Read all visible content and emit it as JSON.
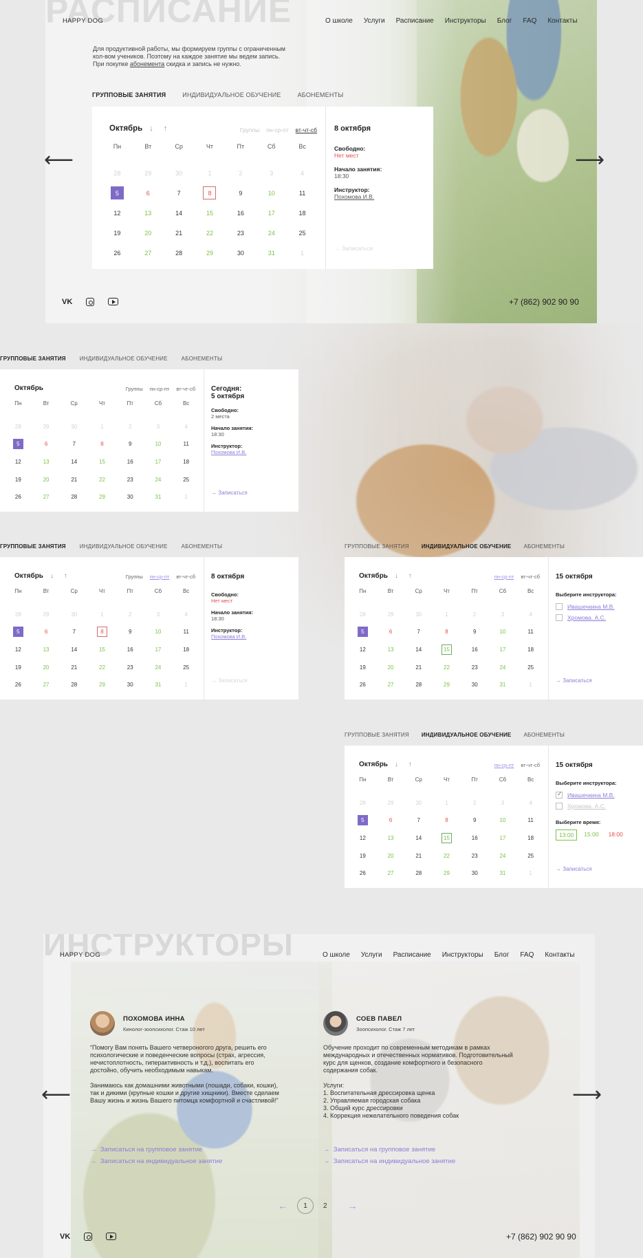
{
  "nav": {
    "logo": "HAPPY DOG",
    "links": [
      "О школе",
      "Услуги",
      "Расписание",
      "Инструкторы",
      "Блог",
      "FAQ",
      "Контакты"
    ]
  },
  "schedule_section": {
    "ghost_title": "РАСПИСАНИЕ",
    "intro_line1": "Для продуктивной работы, мы формируем группы с ограниченным",
    "intro_line2": "кол-вом учеников. Поэтому на каждое занятие мы ведем запись.",
    "intro_line3_pre": "При покупке ",
    "intro_line3_link": "абонемента",
    "intro_line3_post": " скидка и запись не нужно."
  },
  "tabs": [
    "ГРУППОВЫЕ ЗАНЯТИЯ",
    "ИНДИВИДУАЛЬНОЕ ОБУЧЕНИЕ",
    "АБОНЕМЕНТЫ"
  ],
  "calendar": {
    "month": "Октябрь",
    "arrows": "↓ ↑",
    "mode_groups": "Группы",
    "mode_mwf": "пн-ср-пт",
    "mode_tts": "вт-чт-сб",
    "dow": [
      "Пн",
      "Вт",
      "Ср",
      "Чт",
      "Пт",
      "Сб",
      "Вс"
    ],
    "days": [
      [
        "28",
        "29",
        "30",
        "1",
        "2",
        "3",
        "4"
      ],
      [
        "5",
        "6",
        "7",
        "8",
        "9",
        "10",
        "11"
      ],
      [
        "12",
        "13",
        "14",
        "15",
        "16",
        "17",
        "18"
      ],
      [
        "19",
        "20",
        "21",
        "22",
        "23",
        "24",
        "25"
      ],
      [
        "26",
        "27",
        "28",
        "29",
        "30",
        "31",
        "1"
      ]
    ]
  },
  "panel_a": {
    "date": "8 октября",
    "free_label": "Свободно:",
    "free_value": "Нет мест",
    "start_label": "Начало занятия:",
    "start_value": "18:30",
    "instructor_label": "Инструктор:",
    "instructor_value": "Похомова И.В.",
    "enroll": "Записаться"
  },
  "panel_b": {
    "date_line1": "Сегодня:",
    "date_line2": "5 октября",
    "free_label": "Свободно:",
    "free_value": "2 места",
    "start_label": "Начало занятия:",
    "start_value": "18:30",
    "instructor_label": "Инструктор:",
    "instructor_value": "Похомова И.В.",
    "enroll": "Записаться"
  },
  "panel_d": {
    "date": "15 октября",
    "choose_instructor": "Выберите инструктора:",
    "instructor_1": "Ивашечкина М.В.",
    "instructor_2": "Хромова. А.С.",
    "enroll": "Записаться"
  },
  "panel_e": {
    "date": "15 октября",
    "choose_instructor": "Выберите инструктора:",
    "instructor_1": "Ивашечкина М.В.",
    "instructor_2": "Хромова. А.С.",
    "choose_time": "Выберите время:",
    "times": [
      "13:00",
      "15:00",
      "18:00"
    ],
    "enroll": "Записаться"
  },
  "footer": {
    "vk": "vk-icon",
    "instagram": "instagram-icon",
    "youtube": "youtube-icon",
    "phone": "+7 (862) 902 90 90"
  },
  "instructors_section": {
    "ghost_title": "ИНСТРУКТОРЫ",
    "people": [
      {
        "name": "ПОХОМОВА ИННА",
        "role": "Кинолог-зоопсихолог. Стаж 10 лет",
        "desc": "“Помогу Вам понять Вашего четвероногого друга, решить его психологические и поведенческие вопросы (страх, агрессия, нечистоплотность, гиперактивность и т.д.), воспитать его достойно, обучить необходимым навыкам.\n\nЗанимаюсь как домашними животными (лошади, собаки, кошки), так и дикими (крупные кошки и другие хищники). Вместе сделаем Вашу жизнь и жизнь Вашего питомца комфортной и счастливой!”",
        "link_group": "Записаться на групповое занятие",
        "link_individual": "Записаться на индивидуальное занятие"
      },
      {
        "name": "СОЕВ ПАВЕЛ",
        "role": "Зоопсихолог. Стаж 7 лет",
        "desc": "Обучение проходит по современным методикам в рамках международных и отечественных нормативов. Подготовительный курс для щенков, создание комфортного и безопасного содержания собак.\n\nУслуги:\n 1. Воспитательная дрессировка щенка\n 2. Управляемая городская собака\n 3. Общий курс дрессировки\n 4. Коррекция нежелательного поведения собак",
        "link_group": "Записаться на групповое занятие",
        "link_individual": "Записаться на индивидуальное занятие"
      }
    ],
    "pager": {
      "prev": "←",
      "page1": "1",
      "page2": "2",
      "next": "→"
    }
  },
  "icons": {
    "prev_arrow": "⟵",
    "next_arrow": "⟶",
    "enroll_arrow": "→"
  },
  "colors": {
    "accent": "#8b7dd9",
    "selected": "#7f6ac6",
    "red": "#e2504f",
    "green": "#7cc043"
  }
}
